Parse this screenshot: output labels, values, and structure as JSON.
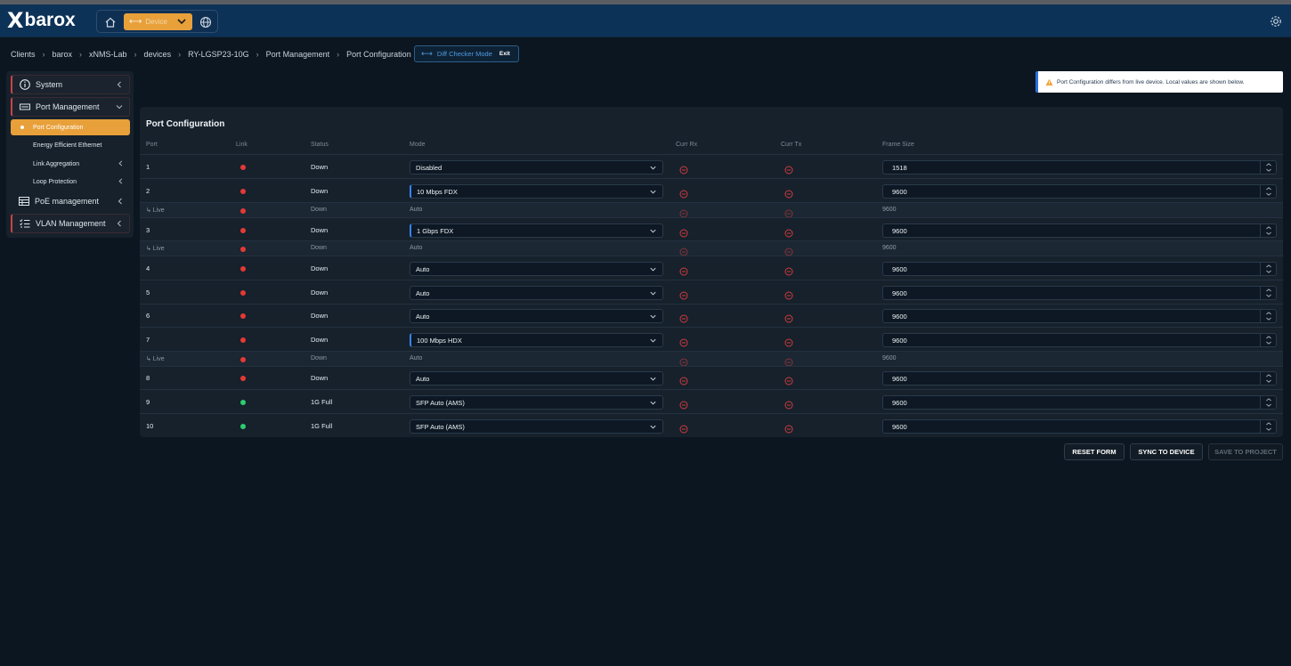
{
  "app": {
    "logo_text": "barox",
    "device_label": "Device"
  },
  "breadcrumb": [
    "Clients",
    "barox",
    "xNMS-Lab",
    "devices",
    "RY-LGSP23-10G",
    "Port Management",
    "Port Configuration"
  ],
  "diff_mode": {
    "label": "Diff Checker Mode",
    "exit": "Exit"
  },
  "sidebar": {
    "system": "System",
    "port_management": "Port Management",
    "port_configuration": "Port Configuration",
    "eee": "Energy Efficient Ethernet",
    "link_aggregation": "Link Aggregation",
    "loop_protection": "Loop Protection",
    "poe": "PoE management",
    "vlan": "VLAN Management"
  },
  "alert": {
    "text": "Port Configuration differs from live device. Local values are shown below."
  },
  "table": {
    "title": "Port Configuration",
    "headers": {
      "port": "Port",
      "link": "Link",
      "status": "Status",
      "mode": "Mode",
      "curr_rx": "Curr Rx",
      "curr_tx": "Curr Tx",
      "frame_size": "Frame Size"
    },
    "rows": [
      {
        "port": "1",
        "status": "Down",
        "mode": "Disabled",
        "frame": "1518"
      },
      {
        "port": "2",
        "status": "Down",
        "mode": "10 Mbps FDX",
        "frame": "9600"
      },
      {
        "port": "↳ Live",
        "status": "Down",
        "mode": "Auto",
        "frame": "9600"
      },
      {
        "port": "3",
        "status": "Down",
        "mode": "1 Gbps FDX",
        "frame": "9600"
      },
      {
        "port": "↳ Live",
        "status": "Down",
        "mode": "Auto",
        "frame": "9600"
      },
      {
        "port": "4",
        "status": "Down",
        "mode": "Auto",
        "frame": "9600"
      },
      {
        "port": "5",
        "status": "Down",
        "mode": "Auto",
        "frame": "9600"
      },
      {
        "port": "6",
        "status": "Down",
        "mode": "Auto",
        "frame": "9600"
      },
      {
        "port": "7",
        "status": "Down",
        "mode": "100 Mbps HDX",
        "frame": "9600"
      },
      {
        "port": "↳ Live",
        "status": "Down",
        "mode": "Auto",
        "frame": "9600"
      },
      {
        "port": "8",
        "status": "Down",
        "mode": "Auto",
        "frame": "9600"
      },
      {
        "port": "9",
        "status": "1G Full",
        "mode": "SFP Auto (AMS)",
        "frame": "9600"
      },
      {
        "port": "10",
        "status": "1G Full",
        "mode": "SFP Auto (AMS)",
        "frame": "9600"
      }
    ]
  },
  "buttons": {
    "reset": "RESET FORM",
    "sync": "SYNC TO DEVICE",
    "save": "SAVE TO PROJECT"
  },
  "colors": {
    "link_down": "#e53935",
    "link_up": "#2ecc71",
    "accent": "#e8a03a",
    "diff_border": "#3b82f6"
  }
}
